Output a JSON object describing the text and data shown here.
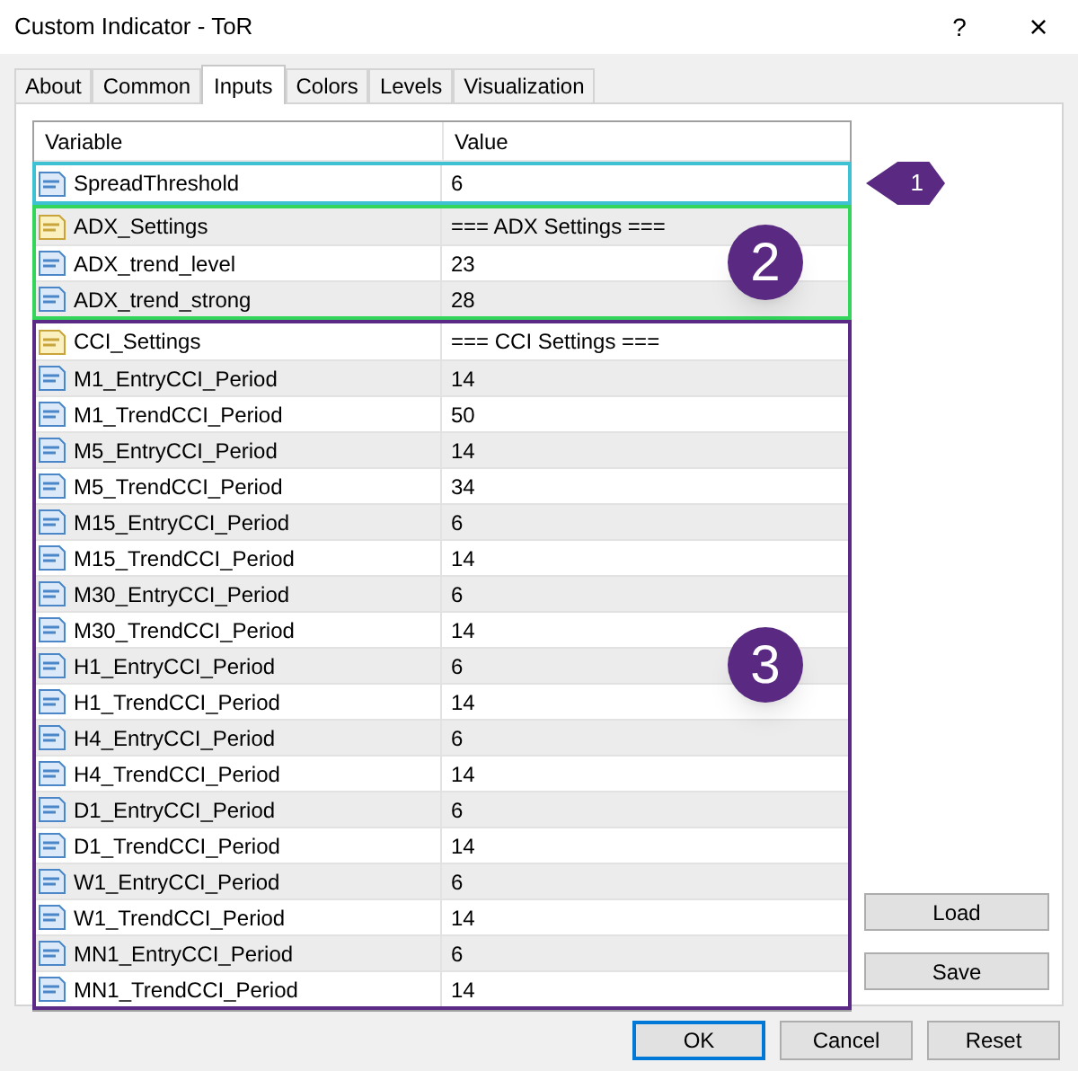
{
  "window": {
    "title": "Custom Indicator - ToR",
    "help": "?",
    "close": "×"
  },
  "tabs": [
    {
      "label": "About",
      "selected": false
    },
    {
      "label": "Common",
      "selected": false
    },
    {
      "label": "Inputs",
      "selected": true
    },
    {
      "label": "Colors",
      "selected": false
    },
    {
      "label": "Levels",
      "selected": false
    },
    {
      "label": "Visualization",
      "selected": false
    }
  ],
  "table": {
    "columns": [
      "Variable",
      "Value"
    ],
    "groups": [
      {
        "color": "#3ec1d3",
        "callout": {
          "kind": "pointer",
          "label": "1"
        },
        "rows": [
          {
            "kind": "number",
            "name": "SpreadThreshold",
            "value": "6"
          }
        ]
      },
      {
        "color": "#33d65a",
        "callout": {
          "kind": "circle",
          "label": "2"
        },
        "rows": [
          {
            "kind": "string",
            "name": "ADX_Settings",
            "value": "=== ADX Settings ==="
          },
          {
            "kind": "number",
            "name": "ADX_trend_level",
            "value": "23"
          },
          {
            "kind": "number",
            "name": "ADX_trend_strong",
            "value": "28"
          }
        ]
      },
      {
        "color": "#5b2a86",
        "callout": {
          "kind": "circle",
          "label": "3"
        },
        "rows": [
          {
            "kind": "string",
            "name": "CCI_Settings",
            "value": "=== CCI Settings ==="
          },
          {
            "kind": "number",
            "name": "M1_EntryCCI_Period",
            "value": "14"
          },
          {
            "kind": "number",
            "name": "M1_TrendCCI_Period",
            "value": "50"
          },
          {
            "kind": "number",
            "name": "M5_EntryCCI_Period",
            "value": "14"
          },
          {
            "kind": "number",
            "name": "M5_TrendCCI_Period",
            "value": "34"
          },
          {
            "kind": "number",
            "name": "M15_EntryCCI_Period",
            "value": "6"
          },
          {
            "kind": "number",
            "name": "M15_TrendCCI_Period",
            "value": "14"
          },
          {
            "kind": "number",
            "name": "M30_EntryCCI_Period",
            "value": "6"
          },
          {
            "kind": "number",
            "name": "M30_TrendCCI_Period",
            "value": "14"
          },
          {
            "kind": "number",
            "name": "H1_EntryCCI_Period",
            "value": "6"
          },
          {
            "kind": "number",
            "name": "H1_TrendCCI_Period",
            "value": "14"
          },
          {
            "kind": "number",
            "name": "H4_EntryCCI_Period",
            "value": "6"
          },
          {
            "kind": "number",
            "name": "H4_TrendCCI_Period",
            "value": "14"
          },
          {
            "kind": "number",
            "name": "D1_EntryCCI_Period",
            "value": "6"
          },
          {
            "kind": "number",
            "name": "D1_TrendCCI_Period",
            "value": "14"
          },
          {
            "kind": "number",
            "name": "W1_EntryCCI_Period",
            "value": "6"
          },
          {
            "kind": "number",
            "name": "W1_TrendCCI_Period",
            "value": "14"
          },
          {
            "kind": "number",
            "name": "MN1_EntryCCI_Period",
            "value": "6"
          },
          {
            "kind": "number",
            "name": "MN1_TrendCCI_Period",
            "value": "14"
          }
        ]
      }
    ]
  },
  "side_buttons": [
    "Load",
    "Save"
  ],
  "buttons": [
    {
      "label": "OK",
      "default": true
    },
    {
      "label": "Cancel",
      "default": false
    },
    {
      "label": "Reset",
      "default": false
    }
  ]
}
